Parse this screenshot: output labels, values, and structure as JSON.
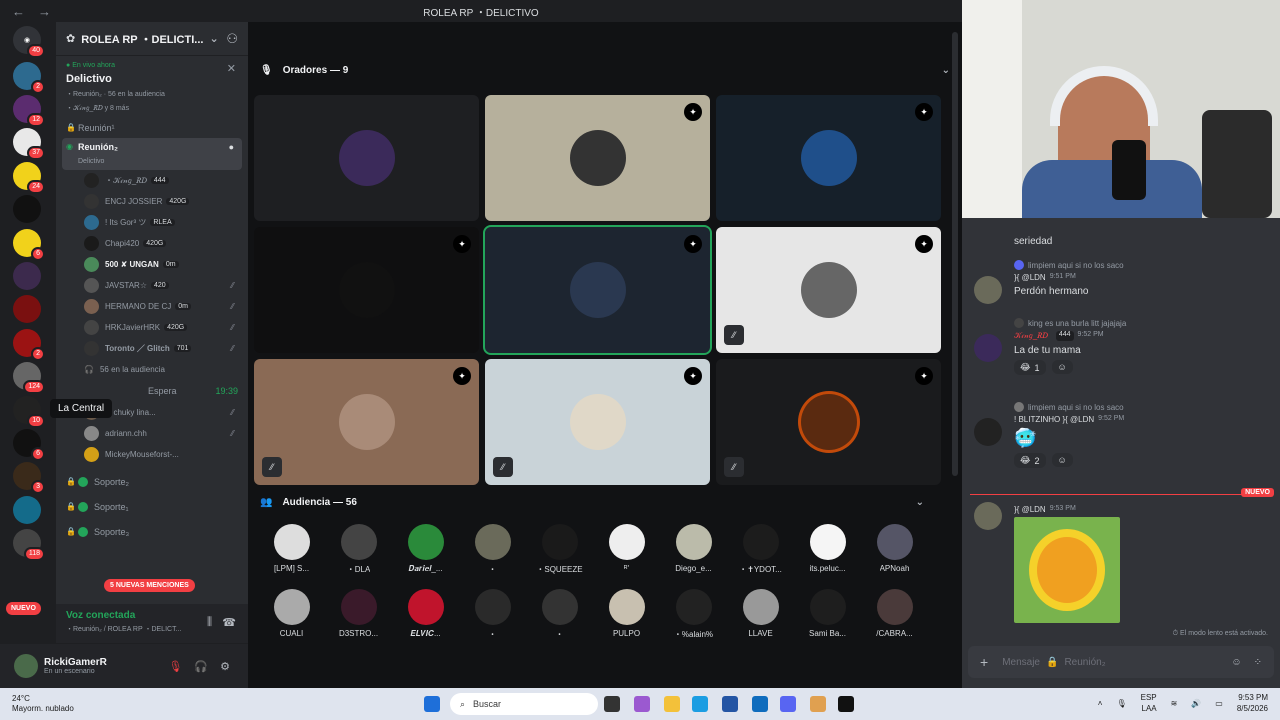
{
  "window": {
    "title": "ROLEA RP ・DELICTIVO",
    "back": "←",
    "forward": "→"
  },
  "servers": [
    {
      "badge": "40",
      "top": 0
    },
    {
      "badge": "2"
    },
    {
      "badge": "12"
    },
    {
      "badge": "37"
    },
    {
      "badge": "24"
    },
    {
      "badge": ""
    },
    {
      "badge": "6"
    },
    {
      "badge": ""
    },
    {
      "badge": ""
    },
    {
      "badge": "2"
    },
    {
      "badge": "124"
    },
    {
      "badge": "10"
    },
    {
      "badge": "6"
    },
    {
      "badge": "3"
    },
    {
      "badge": ""
    },
    {
      "badge": "118"
    }
  ],
  "server_nuevo": "NUEVO",
  "sidebar": {
    "server_name": "ROLEA RP ・DELICTI...",
    "live_label": "En vivo ahora",
    "live_name": "Delictivo",
    "live_sub": "・Reunión₂ · 56 en la audiencia",
    "live_users": "・𝒦𝒾𝓃𝑔_𝑅𝐷 y 8 más",
    "channels": {
      "reunion1": "Reunión¹",
      "reunion2": "Reunión₂",
      "reunion2_sub": "Delictivo"
    },
    "users": [
      {
        "name": "・𝒦𝒾𝓃𝑔_𝑅𝐷",
        "tag": "444"
      },
      {
        "name": "ENCJ JOSSIER",
        "tag": "420G"
      },
      {
        "name": "! Its Gor³ ツ",
        "tag": "RLEA"
      },
      {
        "name": "Chapi420",
        "tag": "420G"
      },
      {
        "name": "500 ✘ UNGAN",
        "tag": "0m"
      },
      {
        "name": "JAVSTAR☆",
        "tag": "420"
      },
      {
        "name": "HERMANO DE CJ",
        "tag": "0m"
      },
      {
        "name": "HRKJavierHRK",
        "tag": "420G"
      },
      {
        "name": "Toronto ／ Glitch",
        "tag": "701"
      }
    ],
    "audience": "56 en la audiencia",
    "espera": "Espera",
    "espera_time": "19:39",
    "espera_users": [
      {
        "name": "cf chuky lina..."
      },
      {
        "name": "adriann.chh"
      },
      {
        "name": "MickeyMouseforst-..."
      }
    ],
    "soporte": [
      "Soporte₂",
      "Soporte₁",
      "Soporte₃"
    ],
    "tooltip": "La Central",
    "mentions": "5 NUEVAS MENCIONES",
    "voice_status": "Voz conectada",
    "voice_loc": "・Reunión₂ / ROLEA RP ・DELICT...",
    "username": "RickiGamerR",
    "user_status": "En un escenario"
  },
  "stage": {
    "speakers_label": "Oradores — 9",
    "audience_label": "Audiencia — 56",
    "audience": [
      "[LPM] S...",
      "・DLA",
      "𝑫𝒂𝒓𝒊𝒆𝒍_...",
      "・",
      "・SQUEEZE",
      "ᴿ'",
      "Diego_e...",
      "・✝YDOT...",
      "its.peluc...",
      "APNoah",
      "CUALI",
      "D3STRO...",
      "𝑬𝑳𝑽𝑰𝑪...",
      "・",
      "・",
      "PULPO",
      "・%alain%",
      "LLAVE",
      "Sami Ba...",
      "/CABRA..."
    ]
  },
  "chat": {
    "m0": "seriedad",
    "m1_reply": "limpiem aqui si no los saco",
    "m1_user": "}{ @LDN",
    "m1_time": "9:51 PM",
    "m1_text": "Perdón hermano",
    "m2_reply": "king es una burla litt jajajaja",
    "m2_user": "𝒦𝒾𝓃𝑔_𝑅𝐷",
    "m2_tag": "444",
    "m2_time": "9:52 PM",
    "m2_text": "La de tu mama",
    "m2_react": "1",
    "m3_reply": "limpiem aqui si no los saco",
    "m3_user": "! BLITZINHO }{ @LDN",
    "m3_time": "9:52 PM",
    "m3_react": "2",
    "nuevo": "NUEVO",
    "m4_user": "}{ @LDN",
    "m4_time": "9:53 PM",
    "slow_mode": "El modo lento está activado.",
    "placeholder": "Mensaje",
    "channel": "Reunión₂"
  },
  "taskbar": {
    "temp": "24°C",
    "weather": "Mayorm. nublado",
    "search": "Buscar",
    "lang1": "ESP",
    "lang2": "LAA",
    "time": "9:53 PM",
    "date": "8/5/2026"
  }
}
